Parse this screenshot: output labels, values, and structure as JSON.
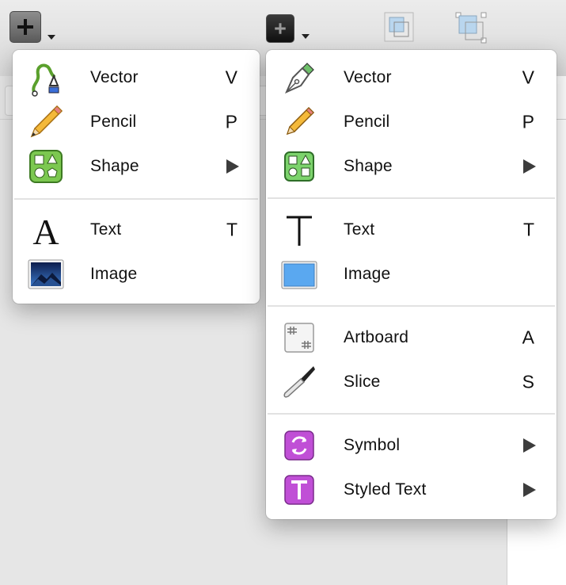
{
  "toolbar": {
    "insert_label": "+"
  },
  "menu_left": {
    "items": [
      {
        "label": "Vector",
        "key": "V",
        "icon": "vector-pen-icon"
      },
      {
        "label": "Pencil",
        "key": "P",
        "icon": "pencil-icon"
      },
      {
        "label": "Shape",
        "key": "",
        "icon": "shape-icon",
        "submenu": true
      },
      {
        "label": "Text",
        "key": "T",
        "icon": "text-icon"
      },
      {
        "label": "Image",
        "key": "",
        "icon": "image-icon"
      }
    ]
  },
  "menu_right": {
    "items": [
      {
        "label": "Vector",
        "key": "V",
        "icon": "pen-nib-icon"
      },
      {
        "label": "Pencil",
        "key": "P",
        "icon": "pencil-icon"
      },
      {
        "label": "Shape",
        "key": "",
        "icon": "shape-icon",
        "submenu": true
      },
      {
        "label": "Text",
        "key": "T",
        "icon": "text-icon"
      },
      {
        "label": "Image",
        "key": "",
        "icon": "image-icon"
      },
      {
        "label": "Artboard",
        "key": "A",
        "icon": "artboard-icon"
      },
      {
        "label": "Slice",
        "key": "S",
        "icon": "slice-knife-icon"
      },
      {
        "label": "Symbol",
        "key": "",
        "icon": "symbol-icon",
        "submenu": true
      },
      {
        "label": "Styled Text",
        "key": "",
        "icon": "styled-text-icon",
        "submenu": true
      }
    ]
  },
  "colors": {
    "vector_green": "#5aa02c",
    "shape_green": "#7cc850",
    "symbol_purple": "#c04fd6",
    "image_blue": "#5aa8f0"
  }
}
